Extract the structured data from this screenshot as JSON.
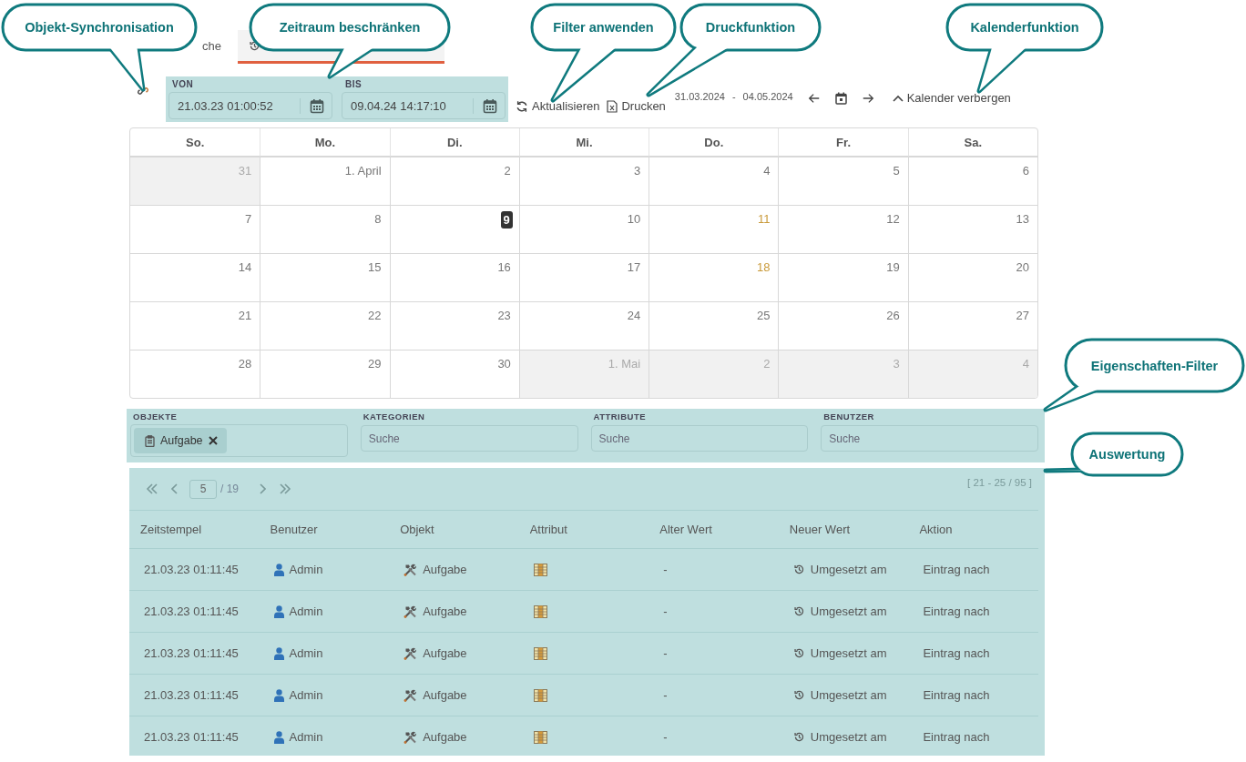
{
  "tabs": [
    {
      "label": "che",
      "selected": false
    },
    {
      "selected": true
    }
  ],
  "period": {
    "from": {
      "label": "VON",
      "value": "21.03.23 01:00:52"
    },
    "to": {
      "label": "BIS",
      "value": "09.04.24 14:17:10"
    }
  },
  "toolbar": {
    "refresh": "Aktualisieren",
    "print": "Drucken",
    "range_start": "31.03.2024",
    "range_separator": "-",
    "range_end": "04.05.2024",
    "toggle_calendar": "Kalender verbergen"
  },
  "calendar": {
    "weekdays": [
      "So.",
      "Mo.",
      "Di.",
      "Mi.",
      "Do.",
      "Fr.",
      "Sa."
    ],
    "weeks": [
      [
        {
          "label": "31",
          "outside": true,
          "today": false,
          "marked": false
        },
        {
          "label": "1. April",
          "outside": false,
          "today": false,
          "marked": false
        },
        {
          "label": "2",
          "outside": false,
          "today": false,
          "marked": false
        },
        {
          "label": "3",
          "outside": false,
          "today": false,
          "marked": false
        },
        {
          "label": "4",
          "outside": false,
          "today": false,
          "marked": false
        },
        {
          "label": "5",
          "outside": false,
          "today": false,
          "marked": false
        },
        {
          "label": "6",
          "outside": false,
          "today": false,
          "marked": false
        }
      ],
      [
        {
          "label": "7",
          "outside": false,
          "today": false,
          "marked": false
        },
        {
          "label": "8",
          "outside": false,
          "today": false,
          "marked": false
        },
        {
          "label": "9",
          "outside": false,
          "today": true,
          "marked": false
        },
        {
          "label": "10",
          "outside": false,
          "today": false,
          "marked": false
        },
        {
          "label": "11",
          "outside": false,
          "today": false,
          "marked": true
        },
        {
          "label": "12",
          "outside": false,
          "today": false,
          "marked": false
        },
        {
          "label": "13",
          "outside": false,
          "today": false,
          "marked": false
        }
      ],
      [
        {
          "label": "14",
          "outside": false,
          "today": false,
          "marked": false
        },
        {
          "label": "15",
          "outside": false,
          "today": false,
          "marked": false
        },
        {
          "label": "16",
          "outside": false,
          "today": false,
          "marked": false
        },
        {
          "label": "17",
          "outside": false,
          "today": false,
          "marked": false
        },
        {
          "label": "18",
          "outside": false,
          "today": false,
          "marked": true
        },
        {
          "label": "19",
          "outside": false,
          "today": false,
          "marked": false
        },
        {
          "label": "20",
          "outside": false,
          "today": false,
          "marked": false
        }
      ],
      [
        {
          "label": "21",
          "outside": false,
          "today": false,
          "marked": false
        },
        {
          "label": "22",
          "outside": false,
          "today": false,
          "marked": false
        },
        {
          "label": "23",
          "outside": false,
          "today": false,
          "marked": false
        },
        {
          "label": "24",
          "outside": false,
          "today": false,
          "marked": false
        },
        {
          "label": "25",
          "outside": false,
          "today": false,
          "marked": false
        },
        {
          "label": "26",
          "outside": false,
          "today": false,
          "marked": false
        },
        {
          "label": "27",
          "outside": false,
          "today": false,
          "marked": false
        }
      ],
      [
        {
          "label": "28",
          "outside": false,
          "today": false,
          "marked": false
        },
        {
          "label": "29",
          "outside": false,
          "today": false,
          "marked": false
        },
        {
          "label": "30",
          "outside": false,
          "today": false,
          "marked": false
        },
        {
          "label": "1. Mai",
          "outside": true,
          "today": false,
          "marked": false
        },
        {
          "label": "2",
          "outside": true,
          "today": false,
          "marked": false
        },
        {
          "label": "3",
          "outside": true,
          "today": false,
          "marked": false
        },
        {
          "label": "4",
          "outside": true,
          "today": false,
          "marked": false
        }
      ]
    ]
  },
  "filters": [
    {
      "label": "OBJEKTE",
      "chips": [
        "Aufgabe"
      ]
    },
    {
      "label": "KATEGORIEN",
      "placeholder": "Suche"
    },
    {
      "label": "ATTRIBUTE",
      "placeholder": "Suche"
    },
    {
      "label": "BENUTZER",
      "placeholder": "Suche"
    }
  ],
  "pager": {
    "page": "5",
    "total": "/ 19",
    "range": "[ 21 - 25 / 95 ]"
  },
  "table": {
    "columns": [
      "Zeitstempel",
      "Benutzer",
      "Objekt",
      "Attribut",
      "Alter Wert",
      "Neuer Wert",
      "Aktion"
    ],
    "rows": [
      {
        "timestamp": "21.03.23 01:11:45",
        "user": "Admin",
        "object": "Aufgabe",
        "old_value": "-",
        "new_value": "Umgesetzt am",
        "action": "Eintrag nach"
      },
      {
        "timestamp": "21.03.23 01:11:45",
        "user": "Admin",
        "object": "Aufgabe",
        "old_value": "-",
        "new_value": "Umgesetzt am",
        "action": "Eintrag nach"
      },
      {
        "timestamp": "21.03.23 01:11:45",
        "user": "Admin",
        "object": "Aufgabe",
        "old_value": "-",
        "new_value": "Umgesetzt am",
        "action": "Eintrag nach"
      },
      {
        "timestamp": "21.03.23 01:11:45",
        "user": "Admin",
        "object": "Aufgabe",
        "old_value": "-",
        "new_value": "Umgesetzt am",
        "action": "Eintrag nach"
      },
      {
        "timestamp": "21.03.23 01:11:45",
        "user": "Admin",
        "object": "Aufgabe",
        "old_value": "-",
        "new_value": "Umgesetzt am",
        "action": "Eintrag nach"
      }
    ]
  },
  "callouts": [
    "Objekt-Synchronisation",
    "Zeitraum beschränken",
    "Filter anwenden",
    "Druckfunktion",
    "Kalenderfunktion",
    "Eigenschaften-Filter",
    "Auswertung"
  ]
}
